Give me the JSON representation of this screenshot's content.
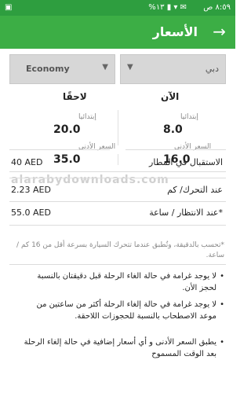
{
  "status_bar": {
    "time": "٨:٥٩ ص",
    "icons": "%١٣ ▮ ▾ ✉",
    "left_icons": "▣"
  },
  "app_bar": {
    "title": "الأسعار",
    "back_icon": "arrow-right-icon"
  },
  "selectors": {
    "class_value": "Economy",
    "city_value": "دبي"
  },
  "columns": {
    "later": {
      "header": "لاحقًا",
      "initial_label": "إبتدائيا",
      "initial_value": "20.0",
      "min_label": "السعر الأدنى",
      "min_value": "35.0"
    },
    "now": {
      "header": "الآن",
      "initial_label": "إبتدائيا",
      "initial_value": "8.0",
      "min_label": "السعر الأدنى",
      "min_value": "16.0"
    }
  },
  "rates": [
    {
      "label": "الاستقبال في المطار",
      "value": "40 AED"
    },
    {
      "label": "عند التحرك/ كم",
      "value": "2.23 AED"
    },
    {
      "label": "عند الانتظار / ساعة*",
      "value": "55.0 AED"
    }
  ],
  "note": "*تحسب بالدقيقة، وتُطبق عندما تتحرك السيارة بسرعة أقل من 16 كم / ساعة.",
  "bullets": [
    "لا يوجد غرامة في حالة الغاء الرحلة قبل دقيقتان بالنسبة لحجز الأن.",
    "لا يوجد غرامة في حالة إلغاء الرحلة أكثر من ساعتين من موعد الاصطحاب بالنسبة للحجوزات اللاحقة.",
    "يطبق السعر الأدنى و أي أسعار إضافية في حالة إلغاء الرحلة بعد الوقت المسموح"
  ],
  "watermark": "alarabydownloads.com",
  "colors": {
    "primary": "#3cae45",
    "status": "#2e9e3f"
  }
}
